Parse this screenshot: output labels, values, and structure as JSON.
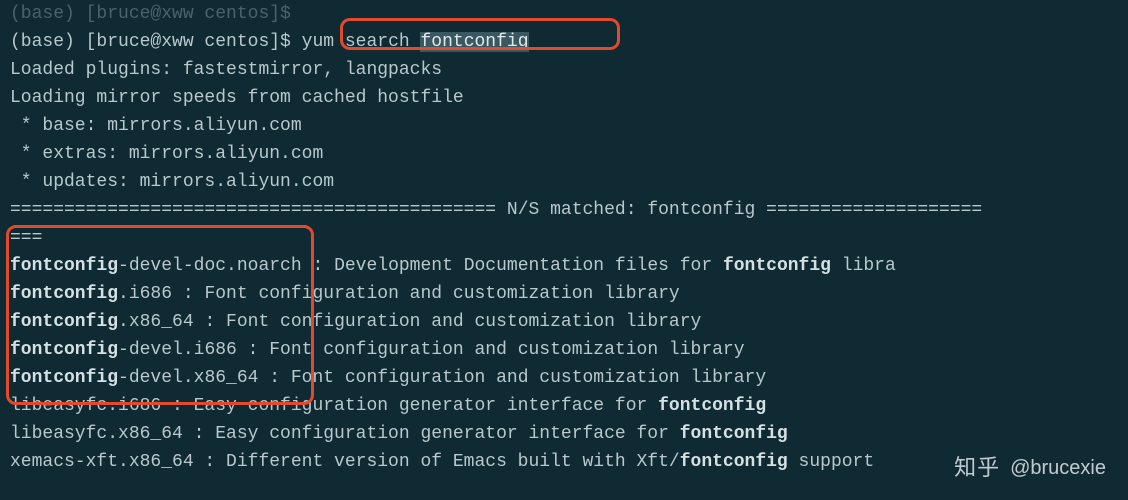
{
  "prompt_prev": "(base) [bruce@xww centos]$",
  "prompt": "(base) [bruce@xww centos]$ ",
  "cmd_prefix": "yum search ",
  "cmd_arg": "fontconfig",
  "plugins": "Loaded plugins: fastestmirror, langpacks",
  "loading": "Loading mirror speeds from cached hostfile",
  "mirror_base": " * base: mirrors.aliyun.com",
  "mirror_extras": " * extras: mirrors.aliyun.com",
  "mirror_updates": " * updates: mirrors.aliyun.com",
  "sep_left": "============================================= ",
  "sep_mid": "N/S matched: fontconfig",
  "sep_right": " ====================",
  "sep_wrap": "===",
  "results": [
    {
      "bold1": "fontconfig",
      "rest1": "-devel-doc.noarch : Development Documentation files for ",
      "bold2": "fontconfig",
      "rest2": " libra"
    },
    {
      "bold1": "fontconfig",
      "rest1": ".i686 : Font configuration and customization library",
      "bold2": "",
      "rest2": ""
    },
    {
      "bold1": "fontconfig",
      "rest1": ".x86_64 : Font configuration and customization library",
      "bold2": "",
      "rest2": ""
    },
    {
      "bold1": "fontconfig",
      "rest1": "-devel.i686 : Font configuration and customization library",
      "bold2": "",
      "rest2": ""
    },
    {
      "bold1": "fontconfig",
      "rest1": "-devel.x86_64 : Font configuration and customization library",
      "bold2": "",
      "rest2": ""
    }
  ],
  "extra": [
    {
      "pre": "libeasyfc.i686 : Easy configuration generator interface for ",
      "bold": "fontconfig",
      "post": ""
    },
    {
      "pre": "libeasyfc.x86_64 : Easy configuration generator interface for ",
      "bold": "fontconfig",
      "post": ""
    },
    {
      "pre": "xemacs-xft.x86_64 : Different version of Emacs built with Xft/",
      "bold": "fontconfig",
      "post": " support"
    }
  ],
  "watermark": {
    "zh": "知乎",
    "handle": "@brucexie"
  }
}
